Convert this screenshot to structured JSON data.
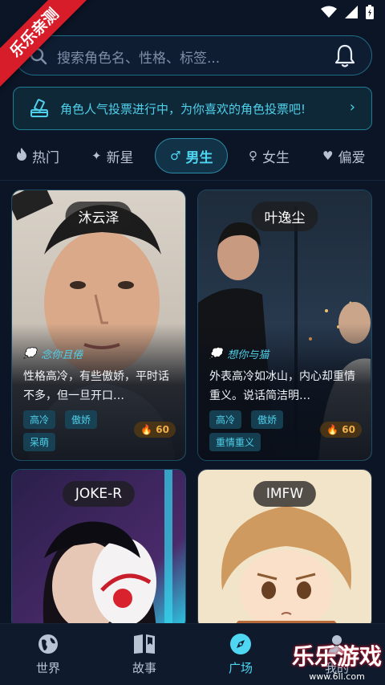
{
  "status": {
    "icons": [
      "wifi-icon",
      "signal-icon",
      "battery-icon"
    ]
  },
  "ribbon": {
    "label": "乐乐亲测"
  },
  "search": {
    "placeholder": "搜索角色名、性格、标签..."
  },
  "banner": {
    "text": "角色人气投票进行中，为你喜欢的角色投票吧!"
  },
  "tabs": [
    {
      "label": "热门",
      "icon": "flame-icon"
    },
    {
      "label": "新星",
      "icon": "sparkle-icon"
    },
    {
      "label": "男生",
      "icon": "male-icon",
      "active": true
    },
    {
      "label": "女生",
      "icon": "female-icon"
    },
    {
      "label": "偏爱",
      "icon": "heart-icon"
    }
  ],
  "cards": [
    {
      "name": "沐云泽",
      "quote": "念你且倦",
      "desc": "性格高冷，有些傲娇，平时话不多，但一旦开口…",
      "tags": [
        "高冷",
        "傲娇",
        "呆萌"
      ],
      "heat": "60"
    },
    {
      "name": "叶逸尘",
      "quote": "想你与猫",
      "desc": "外表高冷如冰山，内心却重情重义。说话简洁明…",
      "tags": [
        "高冷",
        "傲娇",
        "重情重义"
      ],
      "heat": "60"
    },
    {
      "name": "JOKE-R"
    },
    {
      "name": "IMFW"
    }
  ],
  "nav": [
    {
      "label": "世界",
      "icon": "globe-icon"
    },
    {
      "label": "故事",
      "icon": "book-icon"
    },
    {
      "label": "广场",
      "icon": "compass-icon",
      "active": true
    },
    {
      "label": "我的",
      "icon": "profile-icon"
    }
  ],
  "watermark": {
    "title": "乐乐游戏",
    "url": "www.6ll.com"
  },
  "colors": {
    "accent": "#4fd6f2",
    "background": "#0c1526",
    "heat": "#f2b04c"
  }
}
